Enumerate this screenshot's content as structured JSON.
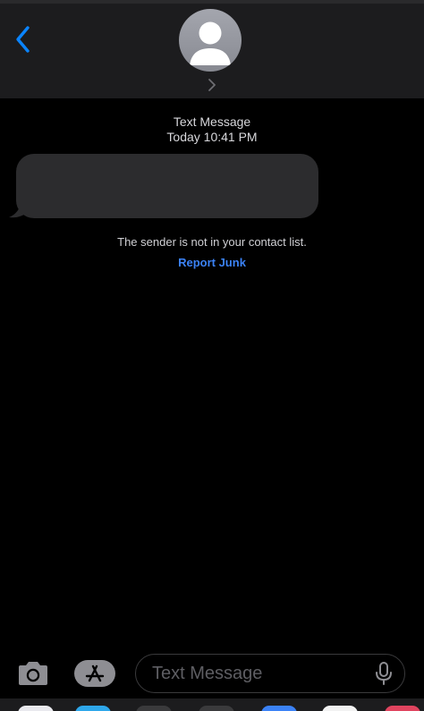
{
  "header": {
    "back_label": "",
    "colors": {
      "accent": "#0a84ff",
      "header_bg": "#1c1c1e"
    }
  },
  "conversation": {
    "service": "Text Message",
    "timestamp": "Today 10:41 PM",
    "notice": "The sender is not in your contact list.",
    "report_junk_label": "Report Junk"
  },
  "composer": {
    "placeholder": "Text Message",
    "icons": [
      "camera-icon",
      "app-store-icon",
      "microphone-icon"
    ]
  },
  "dock": {
    "apps": [
      {
        "name": "dock-app-1",
        "color": "#e9e9ee"
      },
      {
        "name": "dock-app-2",
        "color": "#2ea7ea"
      },
      {
        "name": "dock-app-3",
        "color": "#3a3a3c"
      },
      {
        "name": "dock-app-4",
        "color": "#3a3a3c"
      },
      {
        "name": "dock-app-5",
        "color": "#3b82f6"
      },
      {
        "name": "dock-app-6",
        "color": "#f2f2f2"
      },
      {
        "name": "dock-app-7",
        "color": "#e0445f"
      }
    ]
  }
}
